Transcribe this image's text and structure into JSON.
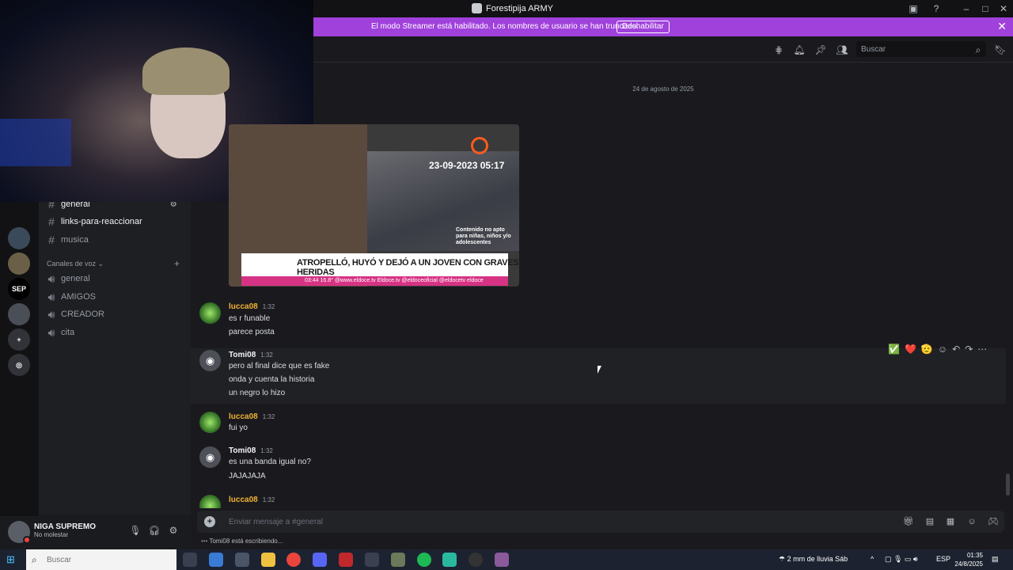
{
  "window": {
    "title": "Forestipija ARMY",
    "icons": [
      "pip-icon",
      "help-icon",
      "minimize-icon",
      "maximize-icon",
      "close-icon"
    ]
  },
  "streamer_banner": {
    "message": "El modo Streamer está habilitado. Los nombres de usuario se han truncado.",
    "button_label": "Deshabilitar",
    "bg_color": "#a041dc"
  },
  "servers": [
    {
      "label": ""
    },
    {
      "label": ""
    },
    {
      "label": "SEP"
    },
    {
      "label": ""
    },
    {
      "label": "+"
    },
    {
      "label": "◎"
    }
  ],
  "channels": {
    "text": [
      {
        "name": "general",
        "active": true
      },
      {
        "name": "links-para-reaccionar",
        "active": true
      },
      {
        "name": "musica",
        "active": false
      }
    ],
    "voice_header": "Canales de voz",
    "voice": [
      "general",
      "AMIGOS",
      "CREADOR",
      "cita"
    ]
  },
  "header": {
    "search_placeholder": "Buscar",
    "icons": [
      "threads-icon",
      "bell-icon",
      "pin-icon",
      "members-icon",
      "search-icon",
      "inbox-icon"
    ]
  },
  "date_divider": "24 de agosto de 2025",
  "embed": {
    "timestamp": "23-09-2023 05:17",
    "warning": "Contenido no apto para niñas, niños y/o adolescentes",
    "headline": "ATROPELLÓ, HUYÓ Y DEJÓ A UN JOVEN CON GRAVES HERIDAS",
    "footer": "03:44   16.8°   @www.eldoce.tv   Eldoce.tv   @eldoceoficial   @eldocetv   eldoce"
  },
  "messages": [
    {
      "author": "lucca08",
      "time": "1:32",
      "lines": [
        "es r funable",
        "parece posta"
      ],
      "avatar": "lucca"
    },
    {
      "author": "Tomi08",
      "time": "1:32",
      "lines": [
        "pero al final dice que es fake",
        "onda y cuenta la historia",
        "un negro lo hizo"
      ],
      "avatar": "discord"
    },
    {
      "author": "lucca08",
      "time": "1:32",
      "lines": [
        "fui yo"
      ],
      "avatar": "lucca"
    },
    {
      "author": "Tomi08",
      "time": "1:32",
      "lines": [
        "es una banda igual no?",
        "JAJAJAJA"
      ],
      "avatar": "discord"
    },
    {
      "author": "lucca08",
      "time": "1:32",
      "lines": [],
      "avatar": "lucca"
    }
  ],
  "hover_reactions": [
    "✅",
    "❤️",
    "🫡"
  ],
  "composer": {
    "placeholder": "Enviar mensaje a #general",
    "typing": "Tomi08 está escribiendo..."
  },
  "user_panel": {
    "name": "NIGA SUPREMO",
    "status": "No molestar"
  },
  "taskbar": {
    "search_placeholder": "Buscar",
    "weather": "2 mm de lluvia Sáb",
    "lang": "ESP",
    "time": "01:35",
    "date": "24/8/2025"
  }
}
